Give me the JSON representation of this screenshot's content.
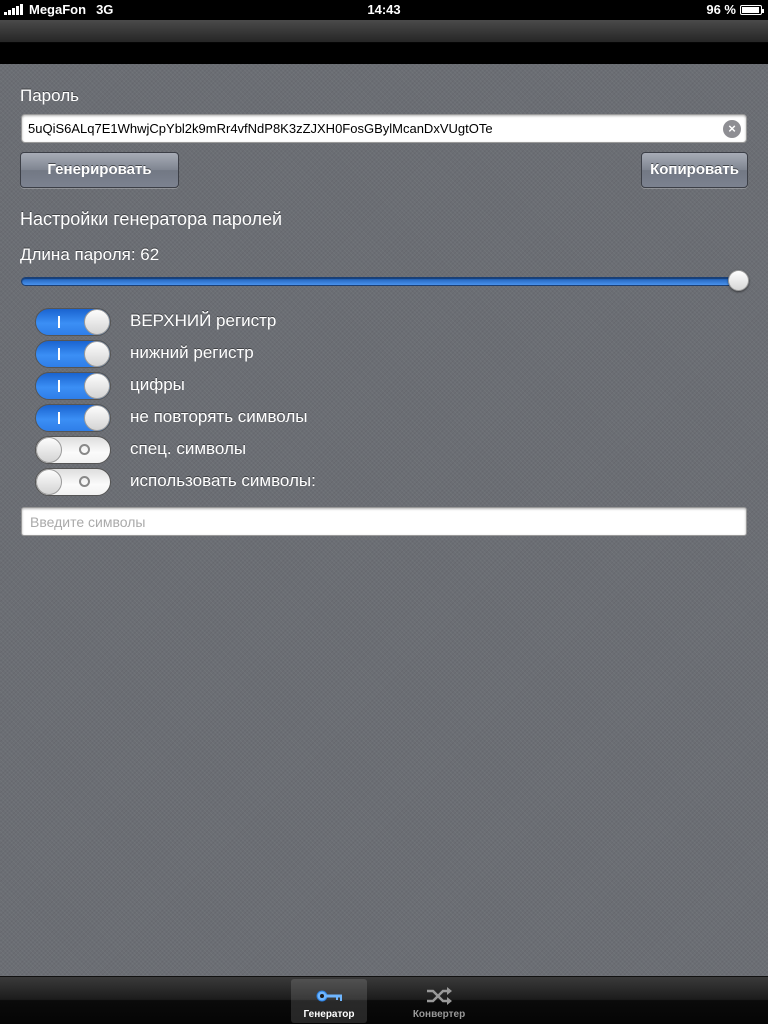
{
  "status": {
    "carrier": "MegaFon",
    "network": "3G",
    "time": "14:43",
    "battery": "96 %"
  },
  "password": {
    "label": "Пароль",
    "value": "5uQiS6ALq7E1WhwjCpYbl2k9mRr4vfNdP8K3zZJXH0FosGBylMcanDxVUgtOTe"
  },
  "buttons": {
    "generate": "Генерировать",
    "copy": "Копировать"
  },
  "settings": {
    "title": "Настройки генератора паролей",
    "length_label": "Длина пароля: 62",
    "slider_fraction": 1.0
  },
  "options": [
    {
      "label": "ВЕРХНИЙ регистр",
      "on": true
    },
    {
      "label": "нижний регистр",
      "on": true
    },
    {
      "label": "цифры",
      "on": true
    },
    {
      "label": "не повторять символы",
      "on": true
    },
    {
      "label": "спец. символы",
      "on": false
    },
    {
      "label": "использовать символы:",
      "on": false
    }
  ],
  "symbols_input": {
    "placeholder": "Введите символы"
  },
  "tabs": [
    {
      "label": "Генератор",
      "icon": "key-icon",
      "active": true
    },
    {
      "label": "Конвертер",
      "icon": "shuffle-icon",
      "active": false
    }
  ],
  "colors": {
    "accent": "#3b8ff5",
    "background": "#6b6e74"
  }
}
